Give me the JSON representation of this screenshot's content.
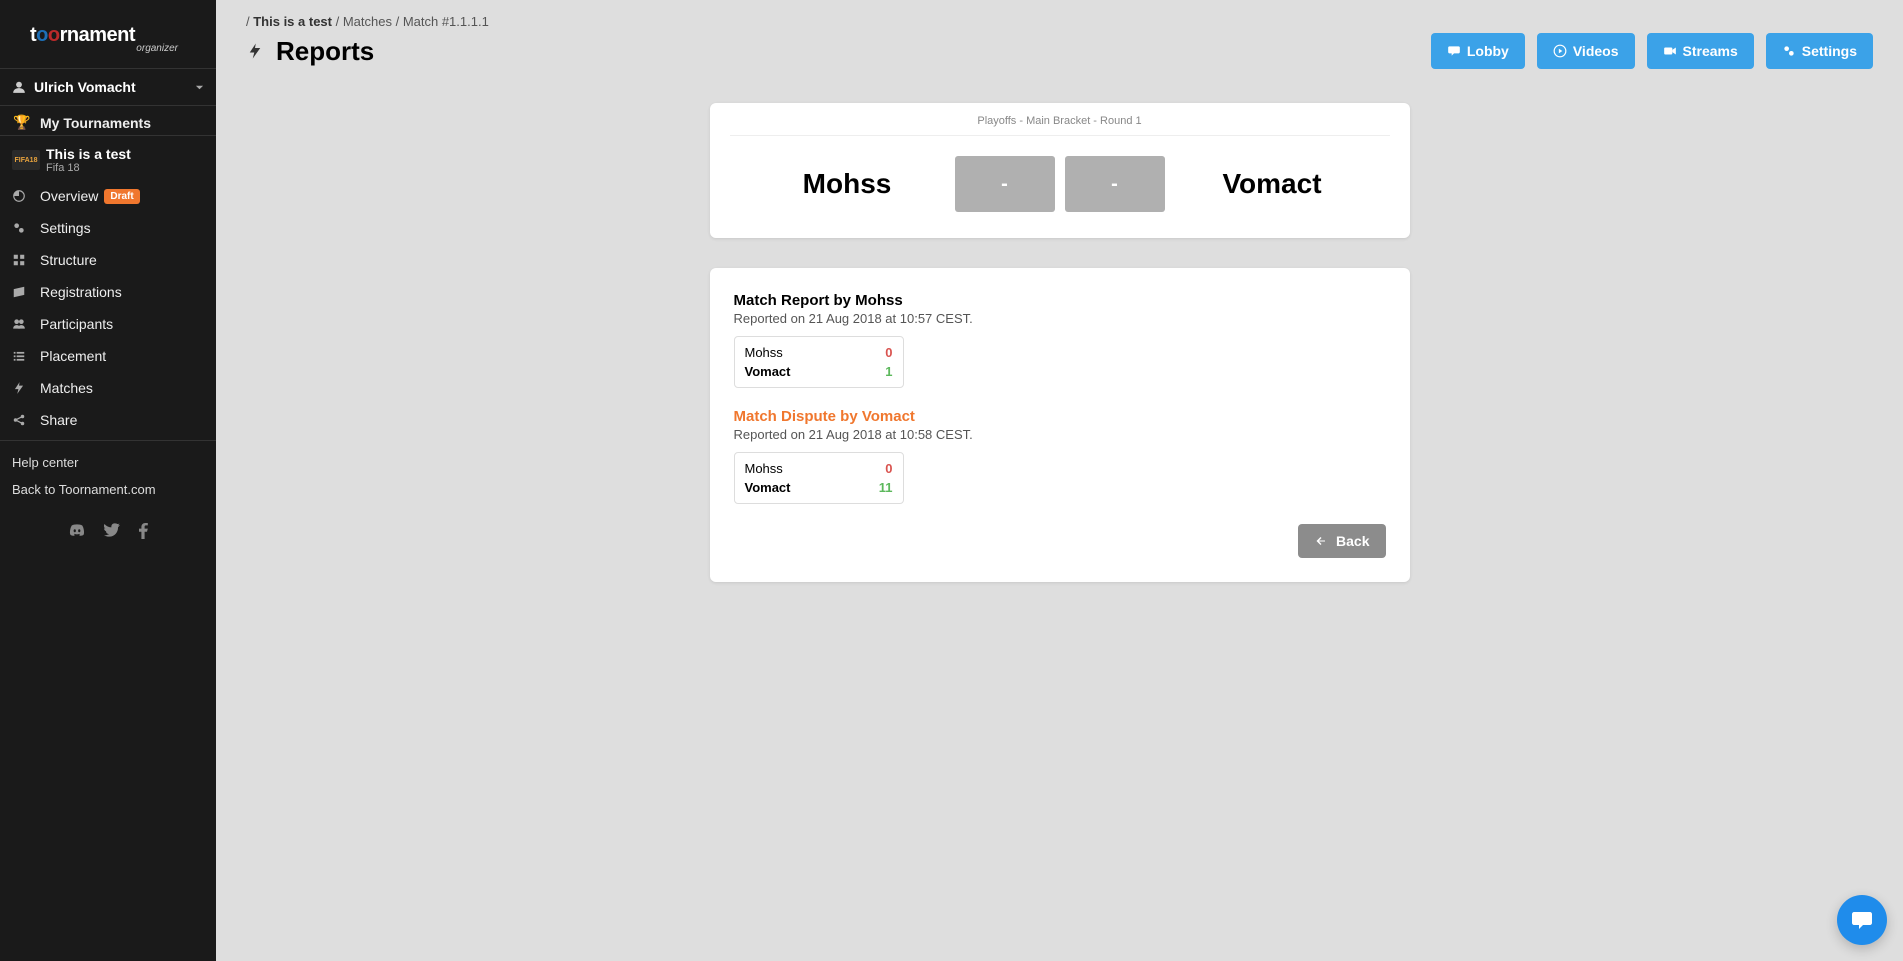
{
  "logo": {
    "main": "toornament",
    "sub": "organizer"
  },
  "user": {
    "name": "Ulrich Vomacht"
  },
  "nav": {
    "my_tournaments": "My Tournaments",
    "tournament": {
      "title": "This is a test",
      "game": "Fifa 18",
      "icon_text": "FIFA18"
    },
    "items": [
      {
        "label": "Overview",
        "badge": "Draft"
      },
      {
        "label": "Settings"
      },
      {
        "label": "Structure"
      },
      {
        "label": "Registrations"
      },
      {
        "label": "Participants"
      },
      {
        "label": "Placement"
      },
      {
        "label": "Matches"
      },
      {
        "label": "Share"
      }
    ],
    "footer": {
      "help": "Help center",
      "back": "Back to Toornament.com"
    }
  },
  "breadcrumb": {
    "tournament": "This is a test",
    "section": "Matches",
    "match": "Match #1.1.1.1"
  },
  "page": {
    "title": "Reports"
  },
  "actions": {
    "lobby": "Lobby",
    "videos": "Videos",
    "streams": "Streams",
    "settings": "Settings"
  },
  "match": {
    "round_label": "Playoffs - Main Bracket - Round 1",
    "team1": "Mohss",
    "team2": "Vomact",
    "score1": "-",
    "score2": "-"
  },
  "reports": [
    {
      "title": "Match Report by Mohss",
      "type": "report",
      "timestamp": "Reported on 21 Aug 2018 at 10:57 CEST.",
      "scores": [
        {
          "name": "Mohss",
          "score": "0",
          "result": "lose"
        },
        {
          "name": "Vomact",
          "score": "1",
          "result": "win"
        }
      ]
    },
    {
      "title": "Match Dispute by Vomact",
      "type": "dispute",
      "timestamp": "Reported on 21 Aug 2018 at 10:58 CEST.",
      "scores": [
        {
          "name": "Mohss",
          "score": "0",
          "result": "lose"
        },
        {
          "name": "Vomact",
          "score": "11",
          "result": "win"
        }
      ]
    }
  ],
  "back_button": "Back"
}
